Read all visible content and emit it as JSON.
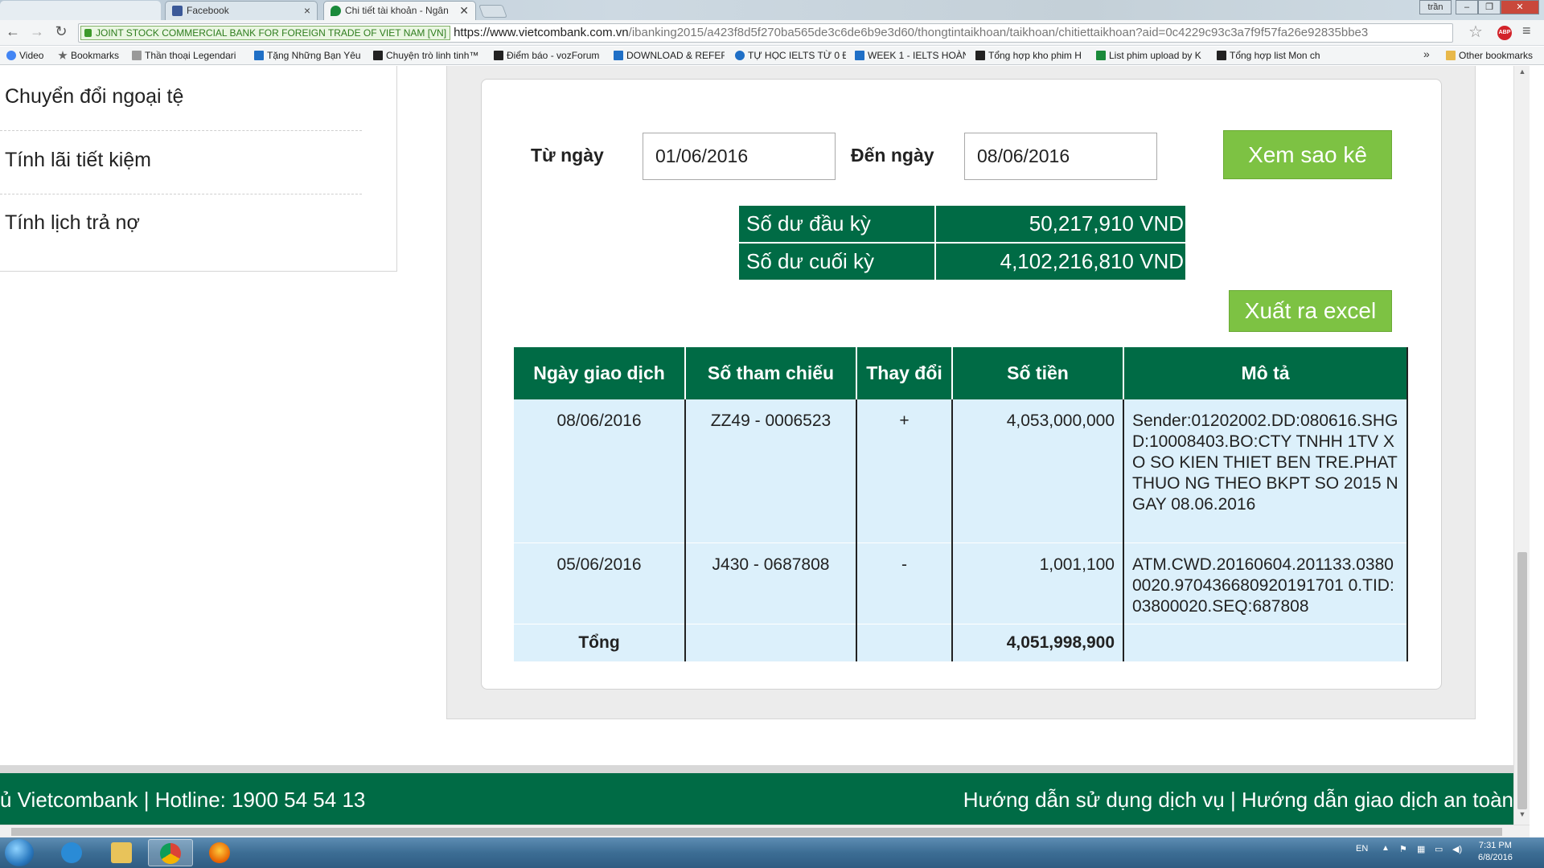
{
  "browser": {
    "tabs": [
      {
        "label": "",
        "icon": "blank-tab"
      },
      {
        "label": "Facebook",
        "icon": "facebook-icon"
      },
      {
        "label": "Chi tiết tài khoản - Ngân",
        "icon": "vietcombank-icon"
      }
    ],
    "window_user": "trần",
    "ev_badge": "JOINT STOCK COMMERCIAL BANK FOR FOREIGN TRADE OF VIET NAM [VN]",
    "url_main": "https://www.vietcombank.com.vn",
    "url_rest": "/ibanking2015/a423f8d5f270ba565de3c6de6b9e3d60/thongtintaikhoan/taikhoan/chitiettaikhoan?aid=0c4229c93c3a7f9f57fa26e92835bbe3",
    "bookmarks": [
      "Video",
      "Bookmarks",
      "Thần thoại Legendari",
      "Tặng Những Bạn Yêu",
      "Chuyện trò linh tinh™",
      "Điểm báo - vozForum",
      "DOWNLOAD & REFER",
      "TỰ HỌC IELTS TỪ 0 Đ",
      "WEEK 1 - IELTS HOÀN",
      "Tổng hợp kho phim H",
      "List phim upload by K",
      "Tổng hợp list Mon ch"
    ],
    "other_bookmarks": "Other bookmarks"
  },
  "sidebar": {
    "items": [
      {
        "label": "Chuyển đổi ngoại tệ"
      },
      {
        "label": "Tính lãi tiết kiệm"
      },
      {
        "label": "Tính lịch trả nợ"
      }
    ]
  },
  "filter": {
    "from_label": "Từ ngày",
    "from_value": "01/06/2016",
    "to_label": "Đến ngày",
    "to_value": "08/06/2016",
    "view_button": "Xem sao kê"
  },
  "balance": {
    "opening_label": "Số dư đầu kỳ",
    "opening_value": "50,217,910 VND",
    "closing_label": "Số dư cuối kỳ",
    "closing_value": "4,102,216,810 VND"
  },
  "export_button": "Xuất ra excel",
  "transactions": {
    "headers": [
      "Ngày giao dịch",
      "Số tham chiếu",
      "Thay đổi",
      "Số tiền",
      "Mô tả"
    ],
    "rows": [
      {
        "date": "08/06/2016",
        "ref": "ZZ49 - 0006523",
        "change": "+",
        "amount": "4,053,000,000",
        "desc": "Sender:01202002.DD:080616.SHGD:10008403.BO:CTY TNHH 1TV XO SO KIEN THIET BEN TRE.PHAT THUO NG THEO BKPT SO 2015 NGAY 08.06.2016"
      },
      {
        "date": "05/06/2016",
        "ref": "J430 - 0687808",
        "change": "-",
        "amount": "1,001,100",
        "desc": "ATM.CWD.20160604.201133.03800020.970436680920191701 0.TID:03800020.SEQ:687808"
      }
    ],
    "total_label": "Tổng",
    "total_value": "4,051,998,900"
  },
  "footer": {
    "left": "ủ Vietcombank | Hotline: 1900 54 54 13",
    "right": "Hướng dẫn sử dụng dịch vụ |  Hướng dẫn giao dịch an toàn"
  },
  "taskbar": {
    "lang": "EN",
    "time": "7:31 PM",
    "date": "6/8/2016"
  },
  "colors": {
    "brand_green": "#006b45",
    "button_green": "#7dc243",
    "row_bg": "#dcf0fb"
  }
}
